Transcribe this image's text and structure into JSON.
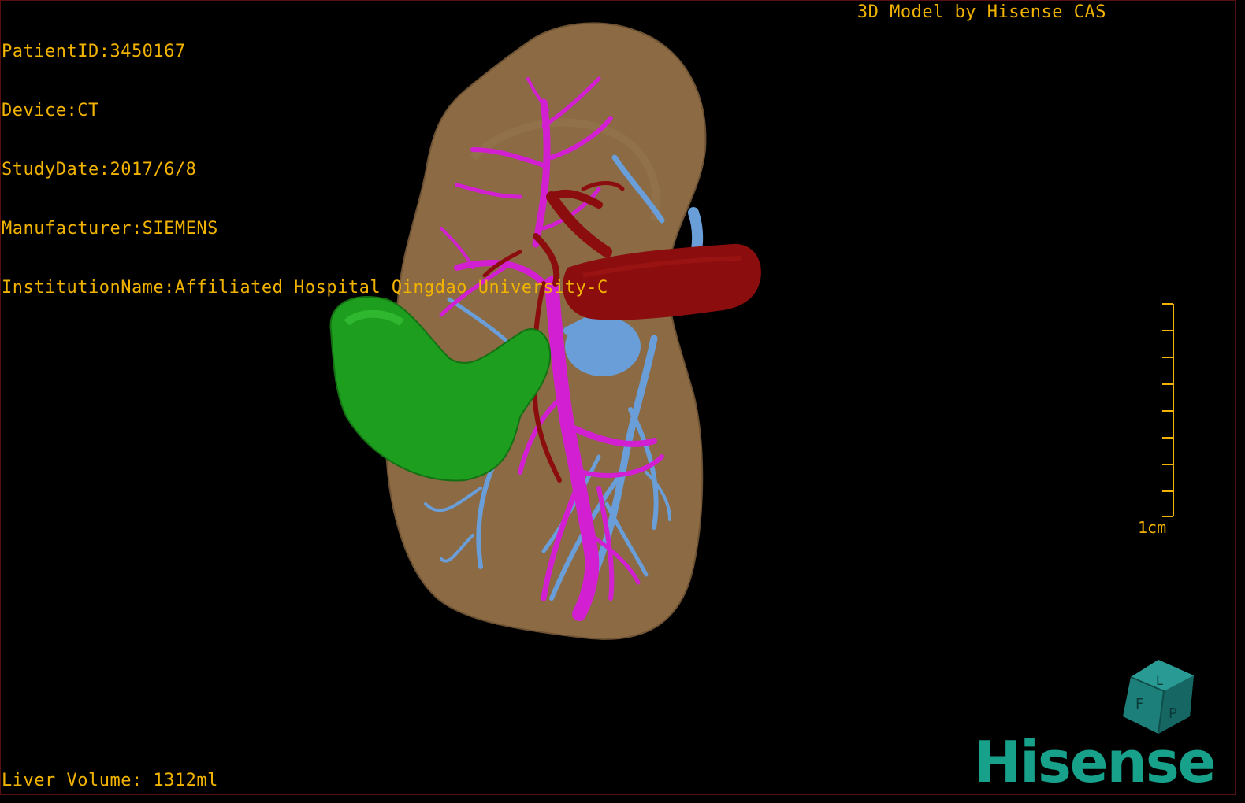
{
  "header": {
    "patient_id": "PatientID:3450167",
    "device": "Device:CT",
    "study_date": "StudyDate:2017/6/8",
    "manufacturer": "Manufacturer:SIEMENS",
    "institution": "InstitutionName:Affiliated Hospital Qingdao University-C"
  },
  "credit": "3D Model by Hisense CAS",
  "scale_label": "1cm",
  "footer": {
    "liver_volume": "Liver Volume: 1312ml"
  },
  "orientation_cube": {
    "labels": [
      "F",
      "L",
      "P"
    ]
  },
  "brand": "Hisense",
  "colors": {
    "overlay_text": "#f2b300",
    "liver": "#8b6a44",
    "gallbladder": "#1e9e1e",
    "artery_vein_red": "#8b0d0d",
    "portal_vein_magenta": "#d21fd2",
    "hepatic_vein_blue": "#6a9ed8",
    "brand_teal": "#17a08a"
  }
}
